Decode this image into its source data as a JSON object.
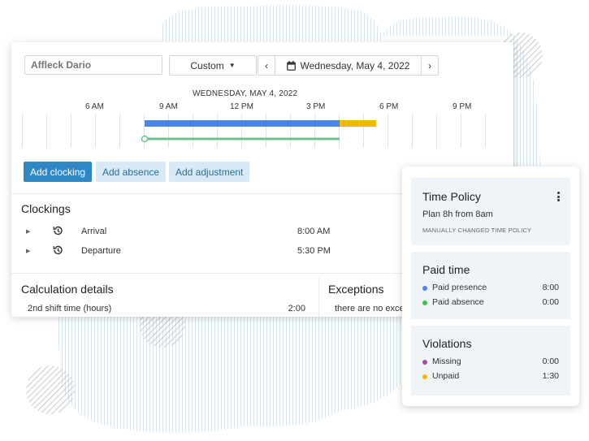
{
  "employee_input": {
    "placeholder": "Affleck Dario"
  },
  "range_select": {
    "label": "Custom"
  },
  "date_nav": {
    "prev": "‹",
    "date": "Wednesday, May 4, 2022",
    "next": "›"
  },
  "timeline": {
    "date_label": "WEDNESDAY, MAY 4, 2022",
    "hours": [
      "6 AM",
      "9 AM",
      "12 PM",
      "3 PM",
      "6 PM",
      "9 PM"
    ],
    "colors": {
      "scheduled": "#4a86e8",
      "overtime": "#f5b800",
      "actual": "#6cc18f"
    }
  },
  "actions": {
    "add_clocking": "Add clocking",
    "add_absence": "Add absence",
    "add_adjustment": "Add adjustment"
  },
  "clockings": {
    "title": "Clockings",
    "rows": [
      {
        "name": "Arrival",
        "time": "8:00 AM"
      },
      {
        "name": "Departure",
        "time": "5:30 PM"
      }
    ]
  },
  "calculation": {
    "title": "Calculation details",
    "rows": [
      {
        "label": "2nd shift time (hours)",
        "value": "2:00"
      }
    ]
  },
  "exceptions": {
    "title": "Exceptions",
    "text": "there are no exce"
  },
  "time_policy": {
    "title": "Time Policy",
    "description": "Plan 8h from 8am",
    "note": "MANUALLY CHANGED TIME POLICY"
  },
  "paid_time": {
    "title": "Paid time",
    "items": [
      {
        "label": "Paid presence",
        "value": "8:00",
        "color": "#4a86e8"
      },
      {
        "label": "Paid absence",
        "value": "0:00",
        "color": "#3cc43c"
      }
    ]
  },
  "violations": {
    "title": "Violations",
    "items": [
      {
        "label": "Missing",
        "value": "0:00",
        "color": "#a64ca6"
      },
      {
        "label": "Unpaid",
        "value": "1:30",
        "color": "#f5b800"
      }
    ]
  }
}
